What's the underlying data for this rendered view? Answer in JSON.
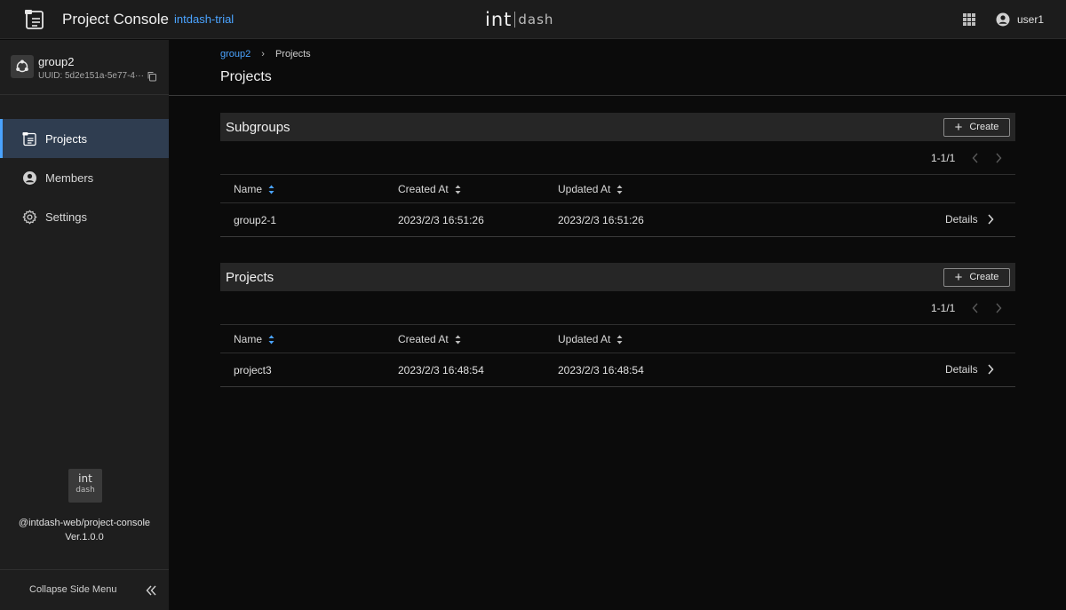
{
  "header": {
    "app_title": "Project Console",
    "org_name": "intdash-trial",
    "brand_int": "int",
    "brand_dash": "dash",
    "user_name": "user1",
    "icons": [
      "app-console-icon",
      "apps-grid-icon",
      "user-avatar-icon"
    ]
  },
  "sidebar": {
    "group": {
      "name": "group2",
      "uuid": "UUID: 5d2e151a-5e77-4···"
    },
    "items": [
      {
        "label": "Projects",
        "icon": "projects-icon",
        "active": true
      },
      {
        "label": "Members",
        "icon": "members-icon",
        "active": false
      },
      {
        "label": "Settings",
        "icon": "gear-icon",
        "active": false
      }
    ],
    "logo_line1": "int",
    "logo_line2": "dash",
    "package_name": "@intdash-web/project-console",
    "version": "Ver.1.0.0",
    "collapse_label": "Collapse Side Menu"
  },
  "breadcrumb": {
    "parent": "group2",
    "separator": "›",
    "current": "Projects"
  },
  "page_title": "Projects",
  "subgroups": {
    "title": "Subgroups",
    "create_label": "Create",
    "pager": "1-1/1",
    "columns": [
      "Name",
      "Created At",
      "Updated At"
    ],
    "rows": [
      {
        "name": "group2-1",
        "created": "2023/2/3 16:51:26",
        "updated": "2023/2/3 16:51:26",
        "action": "Details"
      }
    ]
  },
  "projects": {
    "title": "Projects",
    "create_label": "Create",
    "pager": "1-1/1",
    "columns": [
      "Name",
      "Created At",
      "Updated At"
    ],
    "rows": [
      {
        "name": "project3",
        "created": "2023/2/3 16:48:54",
        "updated": "2023/2/3 16:48:54",
        "action": "Details"
      }
    ]
  },
  "colors": {
    "accent": "#4aa3ff",
    "active_nav_bg": "#2f3d50",
    "header_bg": "#1c1c1c",
    "page_bg": "#0b0b0b"
  }
}
